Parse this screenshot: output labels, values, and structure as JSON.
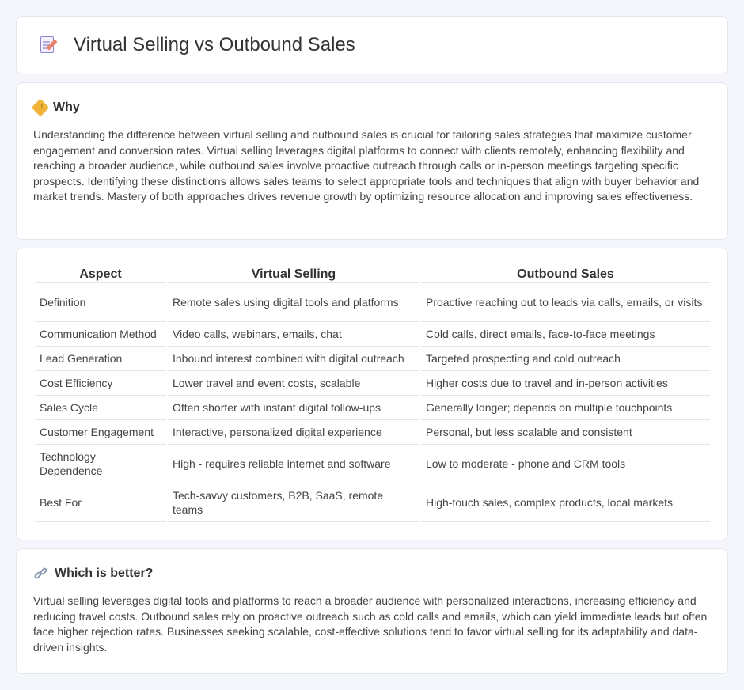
{
  "header": {
    "title": "Virtual Selling vs Outbound Sales"
  },
  "why": {
    "heading": "Why",
    "text": "Understanding the difference between virtual selling and outbound sales is crucial for tailoring sales strategies that maximize customer engagement and conversion rates. Virtual selling leverages digital platforms to connect with clients remotely, enhancing flexibility and reaching a broader audience, while outbound sales involve proactive outreach through calls or in-person meetings targeting specific prospects. Identifying these distinctions allows sales teams to select appropriate tools and techniques that align with buyer behavior and market trends. Mastery of both approaches drives revenue growth by optimizing resource allocation and improving sales effectiveness."
  },
  "table": {
    "headers": [
      "Aspect",
      "Virtual Selling",
      "Outbound Sales"
    ],
    "rows": [
      [
        "Definition",
        "Remote sales using digital tools and platforms",
        "Proactive reaching out to leads via calls, emails, or visits"
      ],
      [
        "Communication Method",
        "Video calls, webinars, emails, chat",
        "Cold calls, direct emails, face-to-face meetings"
      ],
      [
        "Lead Generation",
        "Inbound interest combined with digital outreach",
        "Targeted prospecting and cold outreach"
      ],
      [
        "Cost Efficiency",
        "Lower travel and event costs, scalable",
        "Higher costs due to travel and in-person activities"
      ],
      [
        "Sales Cycle",
        "Often shorter with instant digital follow-ups",
        "Generally longer; depends on multiple touchpoints"
      ],
      [
        "Customer Engagement",
        "Interactive, personalized digital experience",
        "Personal, but less scalable and consistent"
      ],
      [
        "Technology Dependence",
        "High - requires reliable internet and software",
        "Low to moderate - phone and CRM tools"
      ],
      [
        "Best For",
        "Tech-savvy customers, B2B, SaaS, remote teams",
        "High-touch sales, complex products, local markets"
      ]
    ]
  },
  "better": {
    "heading": "Which is better?",
    "text": "Virtual selling leverages digital tools and platforms to reach a broader audience with personalized interactions, increasing efficiency and reducing travel costs. Outbound sales rely on proactive outreach such as cold calls and emails, which can yield immediate leads but often face higher rejection rates. Businesses seeking scalable, cost-effective solutions tend to favor virtual selling for its adaptability and data-driven insights."
  },
  "icons": {
    "title": "document-pencil-icon",
    "why": "diamond-sign-icon",
    "better": "link-icon"
  }
}
